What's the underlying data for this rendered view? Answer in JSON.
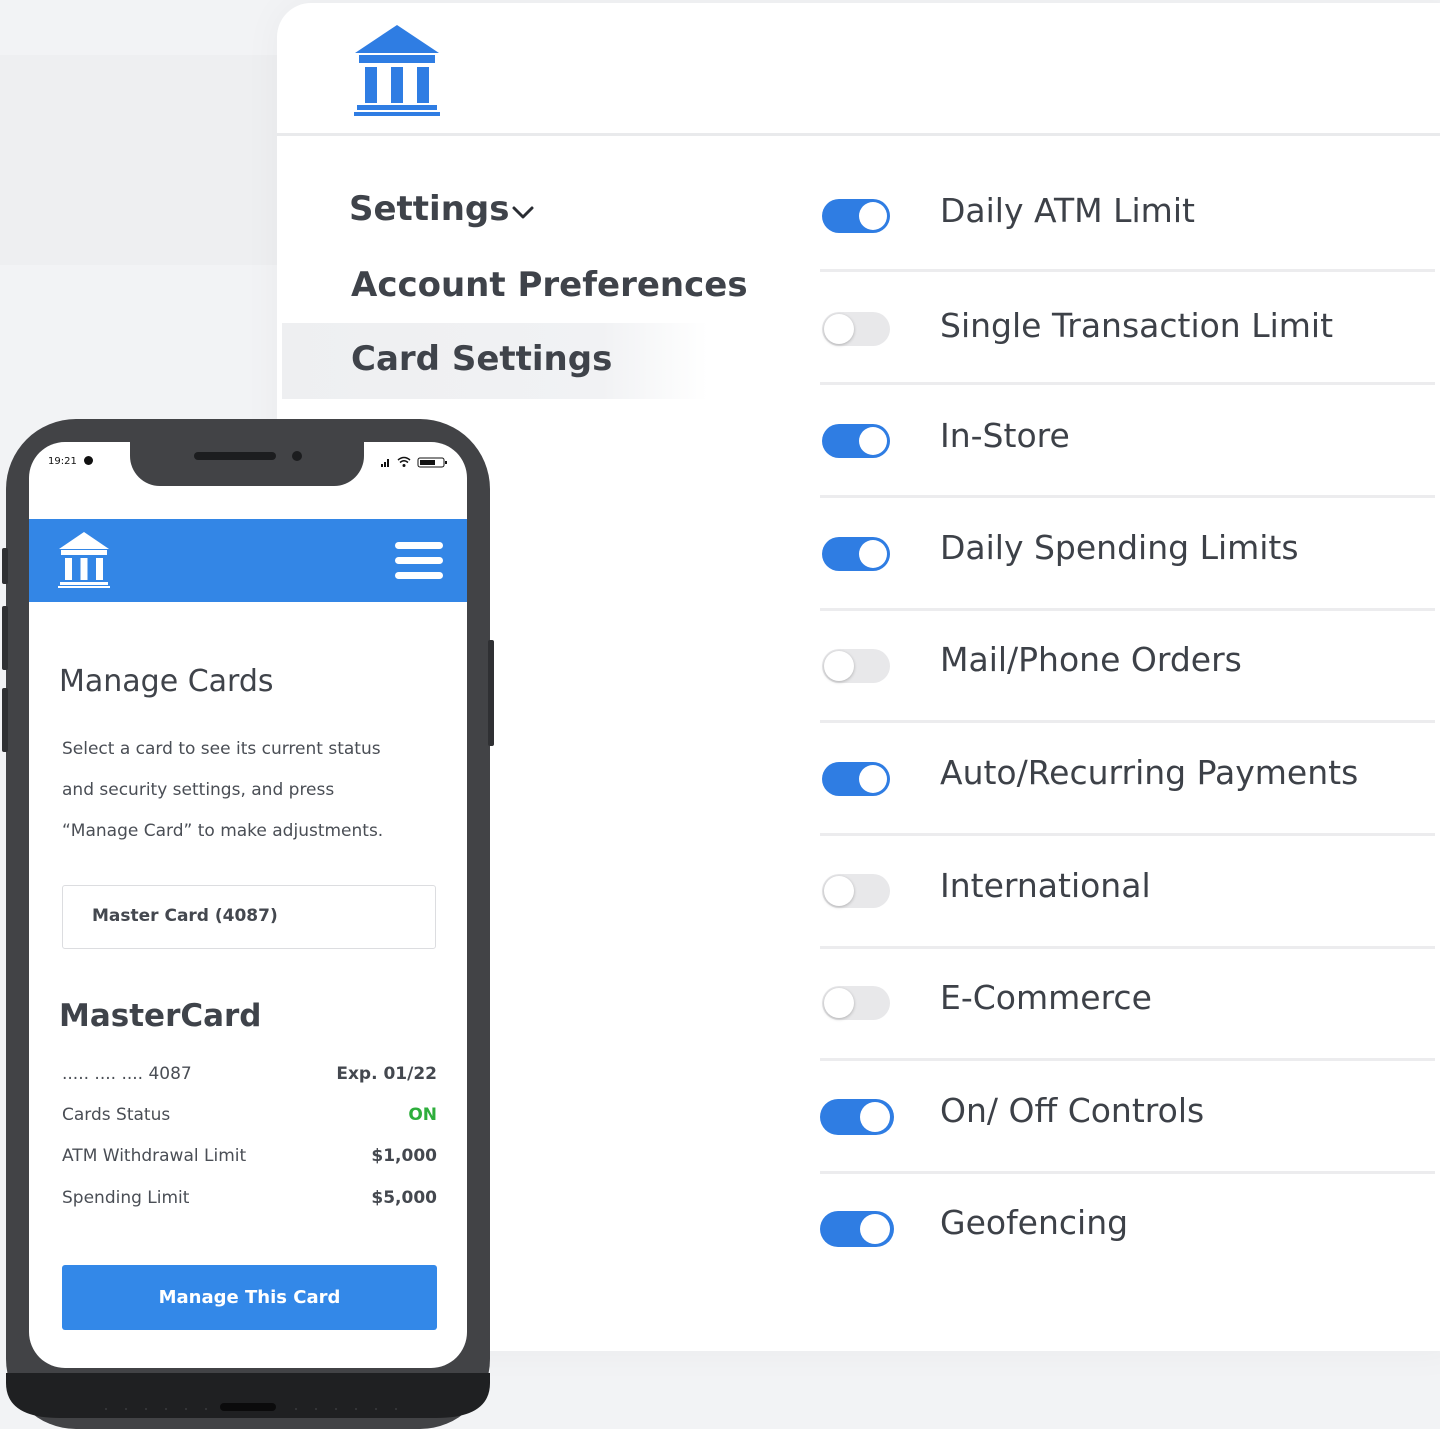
{
  "colors": {
    "accent": "#2f7de3",
    "app_bar": "#3386e6",
    "status_on": "#2eae3c",
    "toggle_off": "#e8e8ea"
  },
  "desktop": {
    "logo_icon": "bank-building-icon",
    "nav": {
      "settings_label": "Settings",
      "settings_icon": "chevron-down-icon",
      "items": [
        {
          "label": "Account Preferences",
          "active": false
        },
        {
          "label": "Card Settings",
          "active": true
        }
      ]
    },
    "toggles": [
      {
        "label": "Daily ATM Limit",
        "on": true
      },
      {
        "label": "Single Transaction Limit",
        "on": false
      },
      {
        "label": "In-Store",
        "on": true
      },
      {
        "label": "Daily Spending Limits",
        "on": true
      },
      {
        "label": "Mail/Phone Orders",
        "on": false
      },
      {
        "label": "Auto/Recurring Payments",
        "on": true
      },
      {
        "label": "International",
        "on": false
      },
      {
        "label": "E-Commerce",
        "on": false
      },
      {
        "label": "On/ Off Controls",
        "on": true
      },
      {
        "label": "Geofencing",
        "on": true
      }
    ]
  },
  "mobile": {
    "status_bar": {
      "time": "19:21"
    },
    "app_bar": {
      "logo_icon": "bank-building-icon",
      "menu_icon": "hamburger-menu-icon"
    },
    "title": "Manage Cards",
    "description_lines": [
      "Select a card to see its current status",
      "and security settings, and press",
      "“Manage Card” to make adjustments."
    ],
    "card_select_value": "Master Card (4087)",
    "card_title": "MasterCard",
    "details": [
      {
        "label": "..... .... .... 4087",
        "value": "Exp. 01/22"
      },
      {
        "label": "Cards Status",
        "value": "ON"
      },
      {
        "label": "ATM Withdrawal Limit",
        "value": "$1,000"
      },
      {
        "label": "Spending Limit",
        "value": "$5,000"
      }
    ],
    "manage_button": "Manage This Card"
  }
}
